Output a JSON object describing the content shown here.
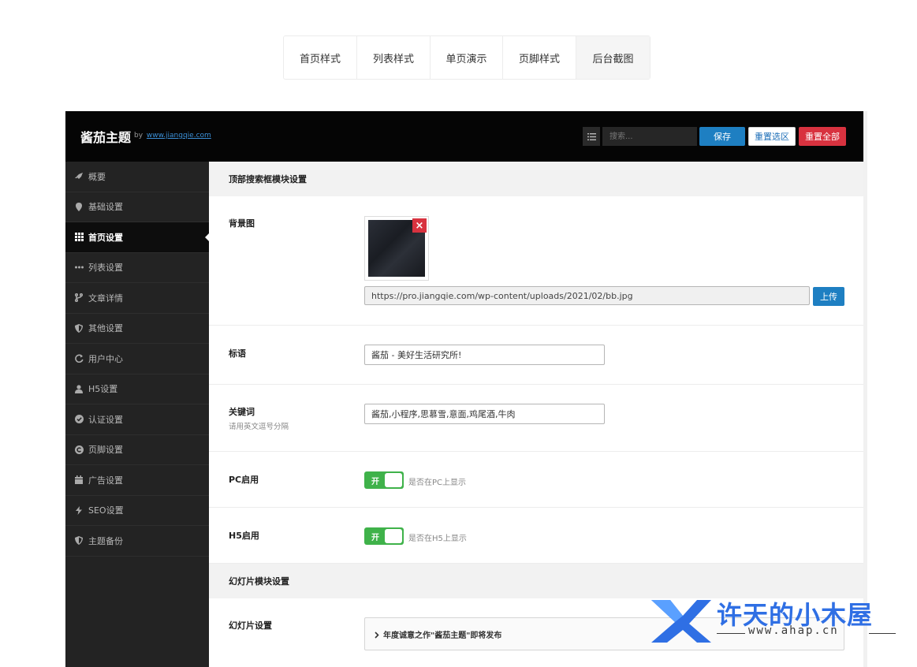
{
  "tabs": [
    {
      "label": "首页样式",
      "active": false
    },
    {
      "label": "列表样式",
      "active": false
    },
    {
      "label": "单页演示",
      "active": false
    },
    {
      "label": "页脚样式",
      "active": false
    },
    {
      "label": "后台截图",
      "active": true
    }
  ],
  "admin": {
    "brand": "酱茄主题",
    "brand_by": "by",
    "brand_link": "www.jiangqie.com",
    "search_placeholder": "搜索...",
    "save_label": "保存",
    "reset_section_label": "重置选区",
    "reset_all_label": "重置全部",
    "sidebar": [
      {
        "label": "概要",
        "icon": "rocket-icon"
      },
      {
        "label": "基础设置",
        "icon": "map-marker-icon"
      },
      {
        "label": "首页设置",
        "icon": "grid-icon",
        "active": true
      },
      {
        "label": "列表设置",
        "icon": "ellipsis-icon"
      },
      {
        "label": "文章详情",
        "icon": "code-fork-icon"
      },
      {
        "label": "其他设置",
        "icon": "shield-icon"
      },
      {
        "label": "用户中心",
        "icon": "refresh-icon"
      },
      {
        "label": "H5设置",
        "icon": "user-icon"
      },
      {
        "label": "认证设置",
        "icon": "check-circle-icon"
      },
      {
        "label": "页脚设置",
        "icon": "copyright-icon"
      },
      {
        "label": "广告设置",
        "icon": "calendar-icon"
      },
      {
        "label": "SEO设置",
        "icon": "bolt-icon"
      },
      {
        "label": "主题备份",
        "icon": "shield-icon"
      }
    ],
    "sections": {
      "search_header": "顶部搜索框模块设置",
      "bg_label": "背景图",
      "bg_url": "https://pro.jiangqie.com/wp-content/uploads/2021/02/bb.jpg",
      "upload_label": "上传",
      "slogan_label": "标语",
      "slogan_value": "酱茄 - 美好生活研究所!",
      "keywords_label": "关键词",
      "keywords_sub": "请用英文逗号分隔",
      "keywords_value": "酱茄,小程序,思慕雪,意面,鸡尾酒,牛肉",
      "pc_label": "PC启用",
      "pc_switch": "开",
      "pc_desc": "是否在PC上显示",
      "h5_label": "H5启用",
      "h5_switch": "开",
      "h5_desc": "是否在H5上显示",
      "slide_header": "幻灯片模块设置",
      "slide_label": "幻灯片设置",
      "slide_item": "年度诚意之作\"酱茄主题\"即将发布"
    }
  },
  "watermark": {
    "title": "许天的小木屋",
    "url": "www.ahap.cn"
  },
  "colors": {
    "primary": "#1e7fc2",
    "danger": "#d8323f",
    "success": "#3fb24a",
    "watermark": "#2f6fe4"
  }
}
